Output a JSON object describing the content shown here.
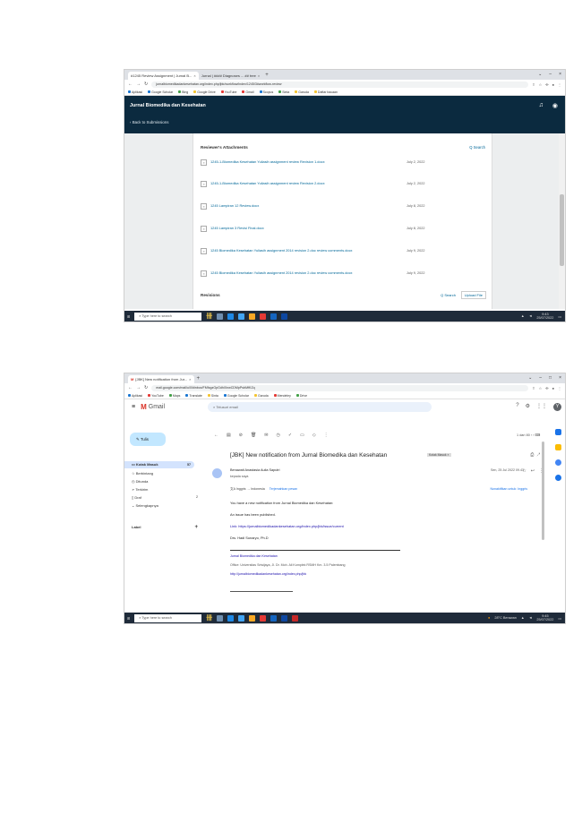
{
  "shot1": {
    "tabs": [
      {
        "label": "#1245 Review Assignment | Jurnal B..."
      },
      {
        "label": "Jurnal | #### Diagnoses ...  ## tree"
      }
    ],
    "url": "jurnalbiomedikadankesehatan.org/index.php/jbk/workflow/index/1245/3#workflow-review",
    "bookmarks": [
      "Aplikasi",
      "Google Scholar",
      "Bing",
      "Google Drive",
      "YouTube",
      "Gmail",
      "Scopus",
      "Sinta",
      "Garuda",
      "Daftar bacaan"
    ],
    "site_title": "Jurnal Biomedika dan Kesehatan",
    "back_link": "Back to Submissions",
    "attachments_heading": "Reviewer's Attachments",
    "attachments_search": "Q Search",
    "attachments": [
      {
        "name": "1245-1-Biomedika Kesehatan Yuliasih assignment review Revision 1.docx",
        "date": "July 2, 2022"
      },
      {
        "name": "1245-1-Biomedika Kesehatan Yuliasih assignment review Revision 2.docx",
        "date": "July 2, 2022"
      },
      {
        "name": "1245 Lampiran 12 Review.docx",
        "date": "July 8, 2022"
      },
      {
        "name": "1245 Lampiran 3 Revisi Final.docx",
        "date": "July 8, 2022"
      },
      {
        "name": "1245 Biomedika Kesehatan Yuliasih assignment 2014 revision 2.doc review comments.docx",
        "date": "July 9, 2022"
      },
      {
        "name": "1245 Biomedika Kesehatan Yuliasih assignment 2014 revision 2.doc review comments.docx",
        "date": "July 9, 2022"
      }
    ],
    "revisions_heading": "Revisions",
    "revisions_search": "Q Search",
    "revisions_upload": "Upload File",
    "taskbar_search": "Type here to search",
    "taskbar_time": "9:43",
    "taskbar_date": "25/07/2022"
  },
  "shot2": {
    "tabs": [
      {
        "label": "[JBK] New notification from Jur..."
      }
    ],
    "url": "mail.google.com/mail/u/0/#inbox/FMfcgzGpGdhlXnwCDMpPsbMfKZq",
    "bookmarks": [
      "Aplikasi",
      "YouTube",
      "Maps",
      "Translate",
      "Sinta",
      "Google Scholar",
      "Garuda",
      "Mendeley",
      "Drive"
    ],
    "brand": "Gmail",
    "search_placeholder": "Telusuri email",
    "compose": "Tulis",
    "nav": [
      {
        "label": "Kotak Masuk",
        "count": "57"
      },
      {
        "label": "Berbintang",
        "count": ""
      },
      {
        "label": "Ditunda",
        "count": ""
      },
      {
        "label": "Terkirim",
        "count": ""
      },
      {
        "label": "Draf",
        "count": "2"
      },
      {
        "label": "Selengkapnya",
        "count": ""
      }
    ],
    "labels_heading": "Label",
    "pagination": "1 dari 80",
    "subject": "[JBK] New notification from Jurnal Biomedika dan Kesehatan",
    "subject_chip": "Kotak Masuk ×",
    "sender": "Benawati Anastasia Aulia Saputri",
    "sender_to": "kepada saya",
    "date": "Sen, 25 Jul 2022 09.43",
    "translate_from": "Inggris",
    "translate_to": "Indonesia",
    "translate_action": "Terjemahkan pesan",
    "translate_off": "Nonaktifkan untuk: Inggris",
    "body": [
      "You have a new notification from Jurnal Biomedika dan Kesehatan:",
      "An issue has been published.",
      "Link: https://jurnalbiomedikadankesehatan.org/index.php/jbk/issue/current",
      "Drs. Hadi Sunaryo, Ph.D"
    ],
    "footer": [
      "Jurnal Biomedika dan Kesehatan",
      "Office: Universitas Sriwijaya, Jl. Dr. Moh. Ali Komplek RSMH Km. 3.5 Palembang",
      "http://jurnalbiomedikadankesehatan.org/index.php/jbk"
    ],
    "taskbar_search": "Type here to search",
    "taskbar_weather": "28°C Berawan",
    "taskbar_time": "9:45",
    "taskbar_date": "25/07/2022"
  }
}
